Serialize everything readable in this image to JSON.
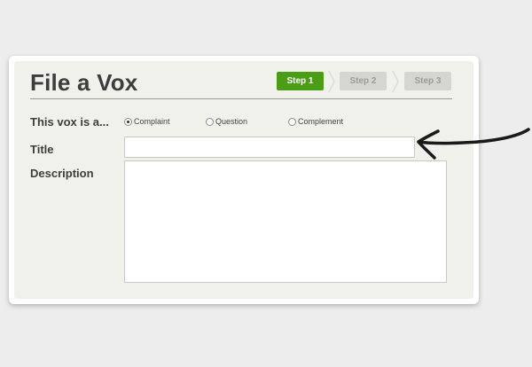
{
  "form": {
    "title": "File a Vox",
    "steps": [
      {
        "label": "Step 1",
        "state": "active"
      },
      {
        "label": "Step 2",
        "state": "inactive"
      },
      {
        "label": "Step 3",
        "state": "inactive"
      }
    ],
    "type_label": "This vox is a...",
    "type_options": [
      {
        "label": "Complaint",
        "selected": true
      },
      {
        "label": "Question",
        "selected": false
      },
      {
        "label": "Complement",
        "selected": false
      }
    ],
    "title_field_label": "Title",
    "title_value": "",
    "description_field_label": "Description",
    "description_value": ""
  },
  "colors": {
    "active_step": "#4a9e16",
    "inactive_step": "#d5d5d2",
    "panel": "#f1f1ec",
    "page_background": "#ededed"
  },
  "icons": {
    "annotation": "hand-drawn-arrow-icon",
    "resize": "resize-grip-icon",
    "step_separator": "chevron-right-icon"
  }
}
